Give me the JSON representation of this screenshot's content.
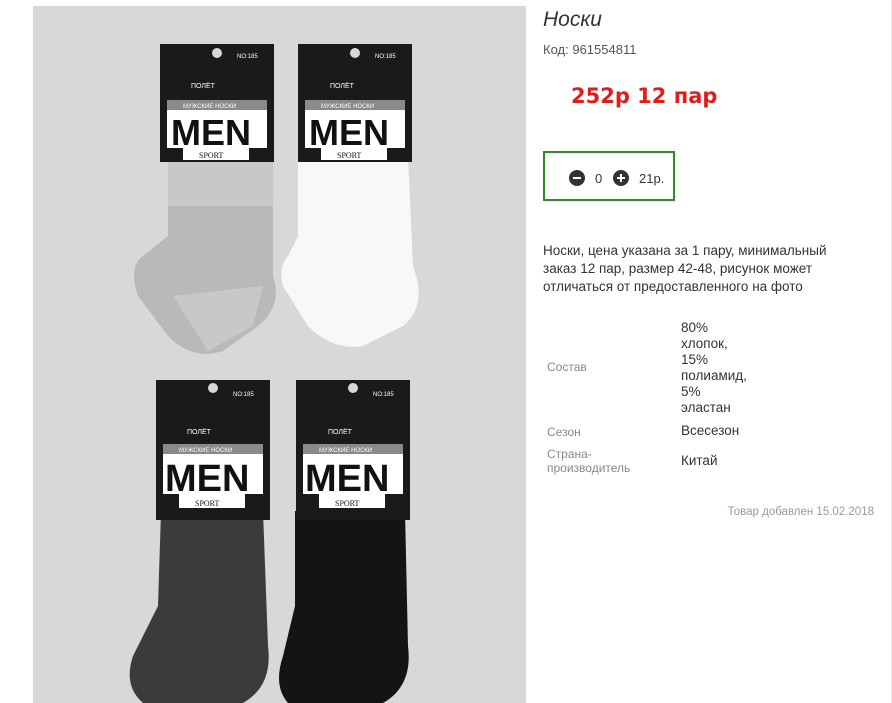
{
  "product": {
    "title": "Носки",
    "code_label": "Код:",
    "code_value": "961554811",
    "price_text": "252р 12 пар",
    "quantity": "0",
    "unit_price": "21р.",
    "description": "Носки, цена указана за 1 пару, минимальный заказ 12 пар, размер 42-48, рисунок может отличаться от предоставленного на фото",
    "added": "Товар добавлен 15.02.2018"
  },
  "specs": {
    "composition_label": "Состав",
    "composition_lines": [
      "80%",
      "хлопок,",
      "15%",
      "полиамид,",
      "5%",
      "эластан"
    ],
    "season_label": "Сезон",
    "season_value": "Всесезон",
    "country_label_line1": "Страна-",
    "country_label_line2": "производитель",
    "country_value": "Китай"
  },
  "photo_labels": {
    "brand": "ПОЛЁТ",
    "no": "NO:185",
    "subtitle": "МУЖСКИЕ НОСКИ",
    "big": "MEN",
    "sport": "SPORT"
  },
  "colors": {
    "price": "#e21b1b",
    "qty_border": "#2e8b26"
  },
  "icons": [
    "minus-circle-icon",
    "plus-circle-icon"
  ]
}
